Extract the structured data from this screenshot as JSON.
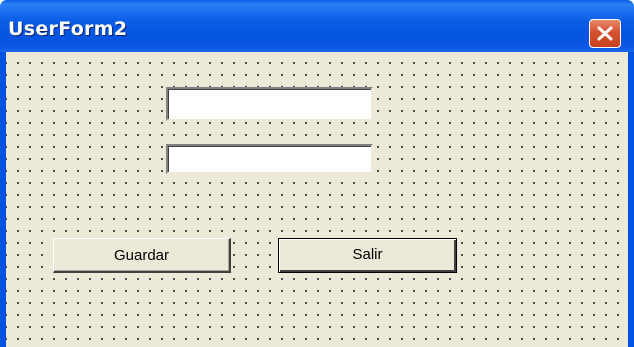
{
  "window": {
    "title": "UserForm2"
  },
  "form": {
    "textbox1_value": "",
    "textbox2_value": ""
  },
  "buttons": {
    "guardar_label": "Guardar",
    "salir_label": "Salir"
  },
  "icons": {
    "close": "close-icon"
  },
  "colors": {
    "titlebar": "#0054e3",
    "client_background": "#ece9d8",
    "close_button": "#d6522f"
  }
}
